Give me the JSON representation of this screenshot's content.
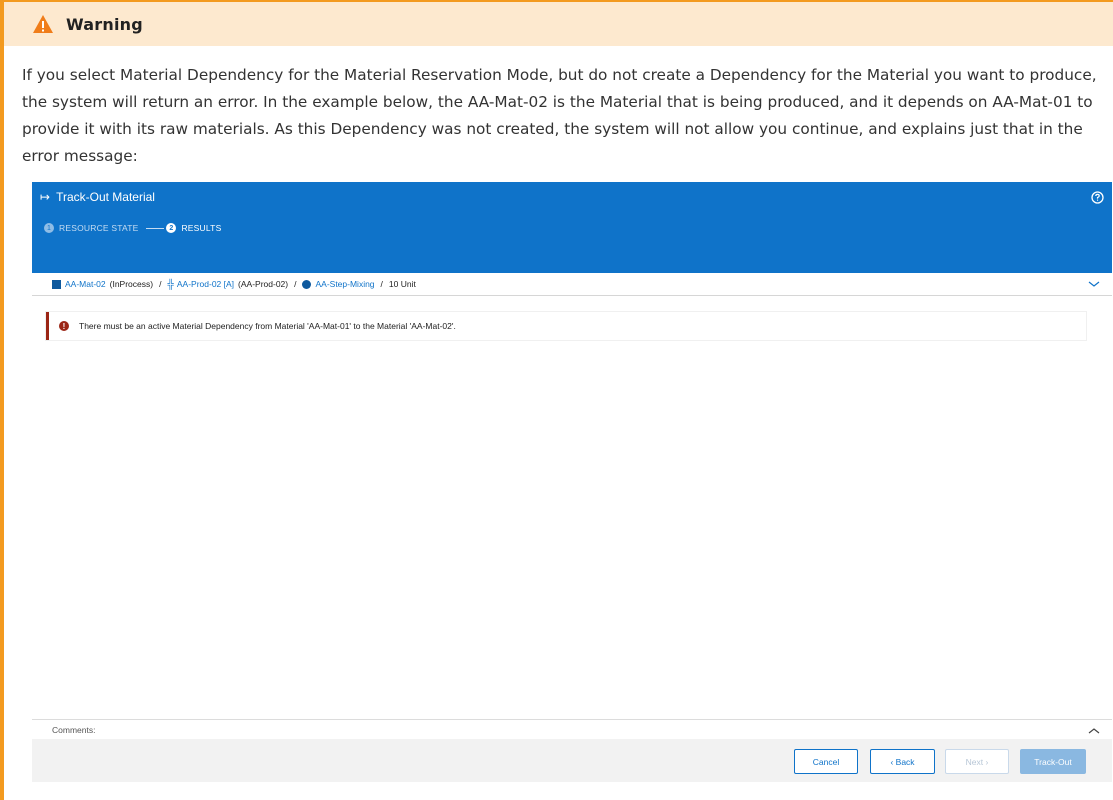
{
  "warning": {
    "title": "Warning",
    "body": "If you select Material Dependency for the Material Reservation Mode, but do not create a Dependency for the Material you want to produce, the system will return an error. In the example below, the AA-Mat-02 is the Material that is being produced, and it depends on AA-Mat-01 to provide it with its raw materials. As this Dependency was not created, the system will not allow you continue, and explains just that in the error message:"
  },
  "app": {
    "title": "Track-Out Material",
    "steps": [
      {
        "number": "1",
        "label": "RESOURCE STATE"
      },
      {
        "number": "2",
        "label": "RESULTS"
      }
    ],
    "breadcrumb": {
      "material": "AA-Mat-02",
      "material_state": "(InProcess)",
      "resource": "AA-Prod-02 [A]",
      "resource_name": "(AA-Prod-02)",
      "step": "AA-Step-Mixing",
      "quantity": "10 Unit",
      "separator": "/"
    },
    "error_message": "There must be an active Material Dependency from Material 'AA-Mat-01' to the Material 'AA-Mat-02'.",
    "comments_label": "Comments:",
    "buttons": {
      "cancel": "Cancel",
      "back": "‹  Back",
      "next": "Next  ›",
      "trackout": "Track-Out"
    }
  },
  "colors": {
    "accent": "#0f73c9",
    "warning_border": "#f39a1f",
    "warning_bg": "#fde9cf",
    "error": "#9b2515"
  }
}
